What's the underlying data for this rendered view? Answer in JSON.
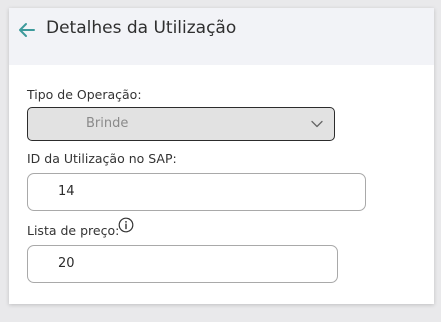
{
  "header": {
    "back_icon": "arrow-left-icon",
    "title": "Detalhes da Utilização",
    "accent_color": "#3d9a9b"
  },
  "form": {
    "operation_type": {
      "label": "Tipo de Operação:",
      "value": "Brinde",
      "disabled": true,
      "icon": "chevron-down-icon"
    },
    "sap_id": {
      "label": "ID da Utilização no SAP:",
      "value": "14"
    },
    "price_list": {
      "label": "Lista de preço:",
      "info_icon": "info-icon",
      "value": "20"
    }
  }
}
